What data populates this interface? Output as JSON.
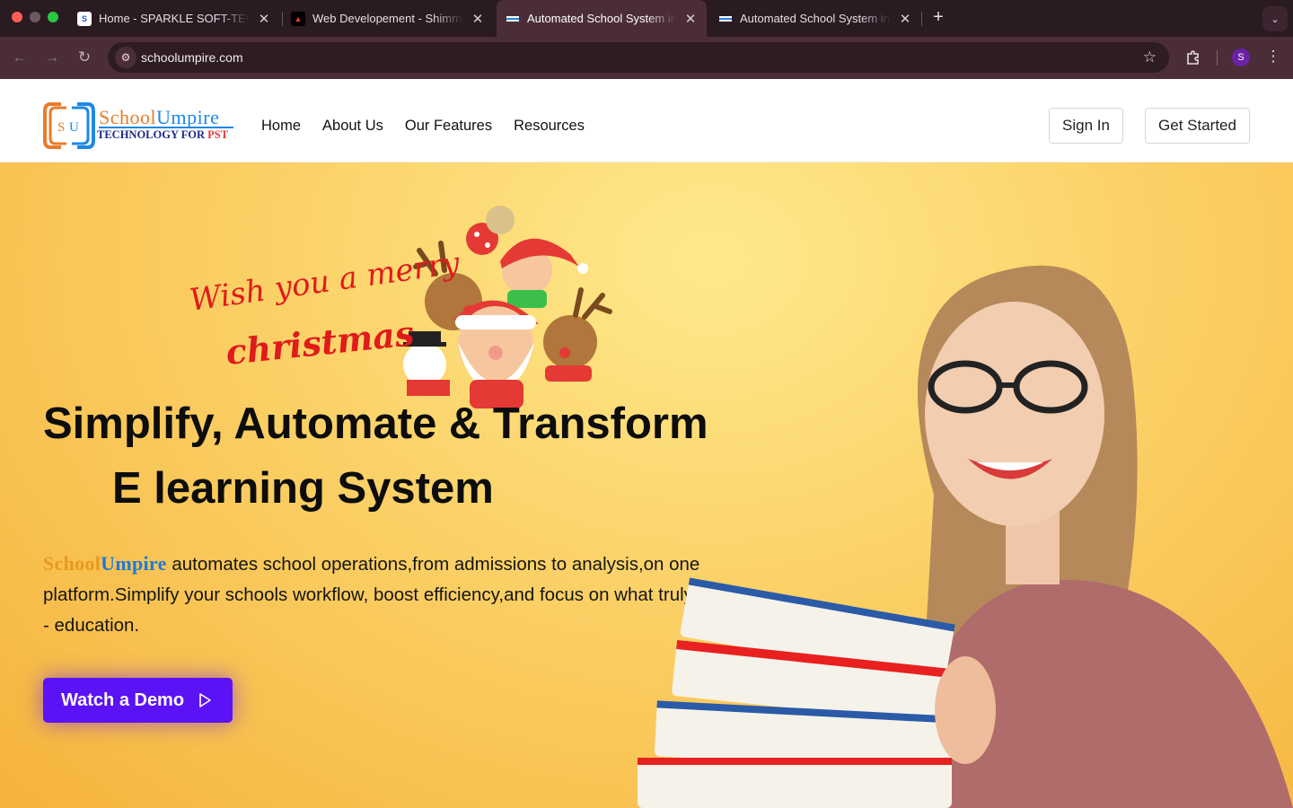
{
  "browser": {
    "tabs": [
      {
        "title": "Home - SPARKLE SOFT-TECH",
        "close": "✕"
      },
      {
        "title": "Web Developement - Shimmer",
        "close": "✕"
      },
      {
        "title": "Automated School System in",
        "close": "✕"
      },
      {
        "title": "Automated School System in",
        "close": "✕"
      }
    ],
    "new_tab": "+",
    "url": "schoolumpire.com",
    "profile_initial": "S"
  },
  "site": {
    "logo": {
      "word_a": "School",
      "word_b": "Umpire",
      "tagline_a": "TECHNOLOGY FOR ",
      "tagline_b": "PST",
      "monogram": "SU"
    },
    "nav": [
      "Home",
      "About Us",
      "Our Features",
      "Resources"
    ],
    "sign_in": "Sign In",
    "get_started": "Get Started"
  },
  "hero": {
    "greeting_line1": "Wish you a merry",
    "greeting_line2": "christmas",
    "title_line1": "Simplify, Automate & Transform",
    "title_line2": "E learning System",
    "brand_a": "School",
    "brand_b": "Umpire",
    "description": " automates school operations,from admissions to analysis,on one platform.Simplify your schools workflow, boost efficiency,and focus on what truly matters - education.",
    "demo_button": "Watch a Demo"
  },
  "colors": {
    "accent": "#5b12f5",
    "hero_bg": "#fbd36a",
    "chrome": "#4b2d38"
  }
}
